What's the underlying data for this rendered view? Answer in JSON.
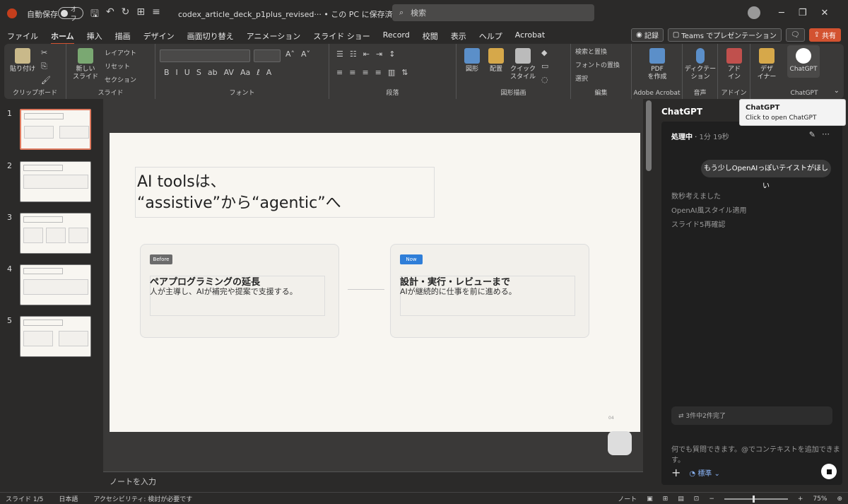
{
  "titlebar": {
    "autosave": "自動保存",
    "toggle": "オフ",
    "filename": "codex_article_deck_p1plus_revised··· • この PC に保存済み ⌄",
    "search": "検索"
  },
  "menu": {
    "items": [
      "ファイル",
      "ホーム",
      "挿入",
      "描画",
      "デザイン",
      "画面切り替え",
      "アニメーション",
      "スライド ショー",
      "Record",
      "校閲",
      "表示",
      "ヘルプ",
      "Acrobat"
    ],
    "record": "記録",
    "teams": "Teams でプレゼンテーション",
    "share": "共有"
  },
  "ribbon": {
    "paste": "貼り付け",
    "clipboard": "クリップボード",
    "new_slide": "新しい\nスライド",
    "layout": "レイアウト",
    "reset": "リセット",
    "section": "セクション",
    "slides": "スライド",
    "font": "フォント",
    "paragraph": "段落",
    "shapes": "図形",
    "arrange": "配置",
    "quick_style": "クイック\nスタイル",
    "drawing": "図形描画",
    "find_replace": "検索と置換",
    "replace_font": "フォントの置換",
    "select": "選択",
    "editing": "編集",
    "pdf": "PDF\nを作成",
    "adobe": "Adobe Acrobat",
    "dictate": "ディクテー\nション",
    "voice": "音声",
    "addins_btn": "アド\nイン",
    "addins": "アドイン",
    "designer": "デザ\nイナー",
    "chatgpt_btn": "ChatGPT",
    "chatgpt_group": "ChatGPT"
  },
  "thumbnails": [
    {
      "num": "1",
      "selected": true
    },
    {
      "num": "2",
      "selected": false
    },
    {
      "num": "3",
      "selected": false
    },
    {
      "num": "4",
      "selected": false
    },
    {
      "num": "5",
      "selected": false
    }
  ],
  "slide": {
    "title": "AI toolsは、\n“assistive”から“agentic”へ",
    "before_tag": "Before",
    "before_heading": "ペアプログラミングの延長",
    "before_text": "人が主導し、AIが補完や提案で支援する。",
    "now_tag": "Now",
    "now_heading": "設計・実行・レビューまで",
    "now_text": "AIが継続的に仕事を前に進める。",
    "page": "04"
  },
  "notes_placeholder": "ノートを入力",
  "chat": {
    "header": "ChatGPT",
    "status": "処理中",
    "elapsed": "1分 19秒",
    "user_message": "もう少しOpenAIっぽいテイストがほしい",
    "log": [
      "数秒考えました",
      "OpenAI風スタイル適用",
      "スライド5再確認"
    ],
    "tasks": "3件中2件完了",
    "input_placeholder": "何でも質問できます。@でコンテキストを追加できます。",
    "mode": "標準"
  },
  "tooltip": {
    "title": "ChatGPT",
    "text": "Click to open ChatGPT"
  },
  "statusbar": {
    "slide": "スライド 1/5",
    "lang": "日本語",
    "accessibility": "アクセシビリティ: 検討が必要です",
    "notes": "ノート",
    "zoom": "75%"
  },
  "colors": {
    "accent": "#d35230",
    "before_tag": "#6b6b6b",
    "now_tag": "#2f7ed8"
  }
}
